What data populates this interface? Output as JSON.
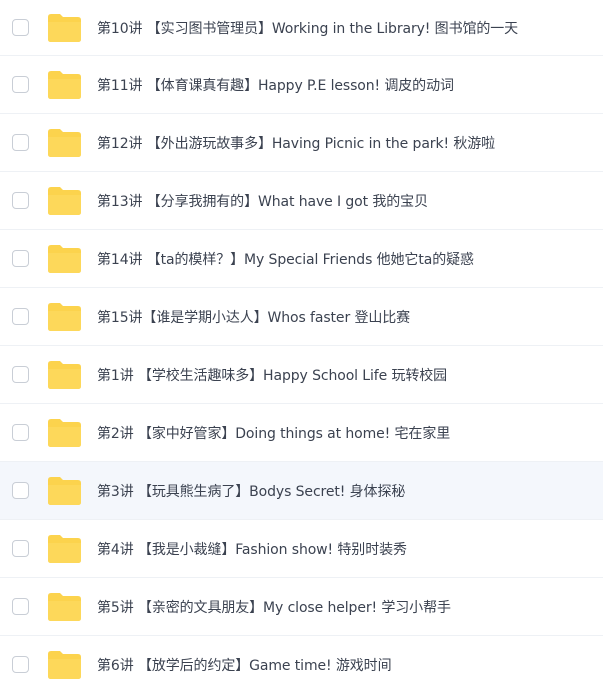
{
  "folder_icon_color": "#fcd34d",
  "files": [
    {
      "name": "第10讲 【实习图书管理员】Working in the Library! 图书馆的一天"
    },
    {
      "name": "第11讲 【体育课真有趣】Happy P.E lesson! 调皮的动词"
    },
    {
      "name": "第12讲 【外出游玩故事多】Having Picnic in the park! 秋游啦"
    },
    {
      "name": "第13讲 【分享我拥有的】What have I got 我的宝贝"
    },
    {
      "name": "第14讲 【ta的模样？】My Special Friends 他她它ta的疑惑"
    },
    {
      "name": "第15讲【谁是学期小达人】Whos faster 登山比赛"
    },
    {
      "name": "第1讲 【学校生活趣味多】Happy School Life 玩转校园"
    },
    {
      "name": "第2讲 【家中好管家】Doing things at home! 宅在家里"
    },
    {
      "name": "第3讲 【玩具熊生病了】Bodys Secret! 身体探秘"
    },
    {
      "name": "第4讲 【我是小裁缝】Fashion show! 特别时装秀"
    },
    {
      "name": "第5讲 【亲密的文具朋友】My close helper! 学习小帮手"
    },
    {
      "name": "第6讲 【放学后的约定】Game time! 游戏时间"
    }
  ]
}
